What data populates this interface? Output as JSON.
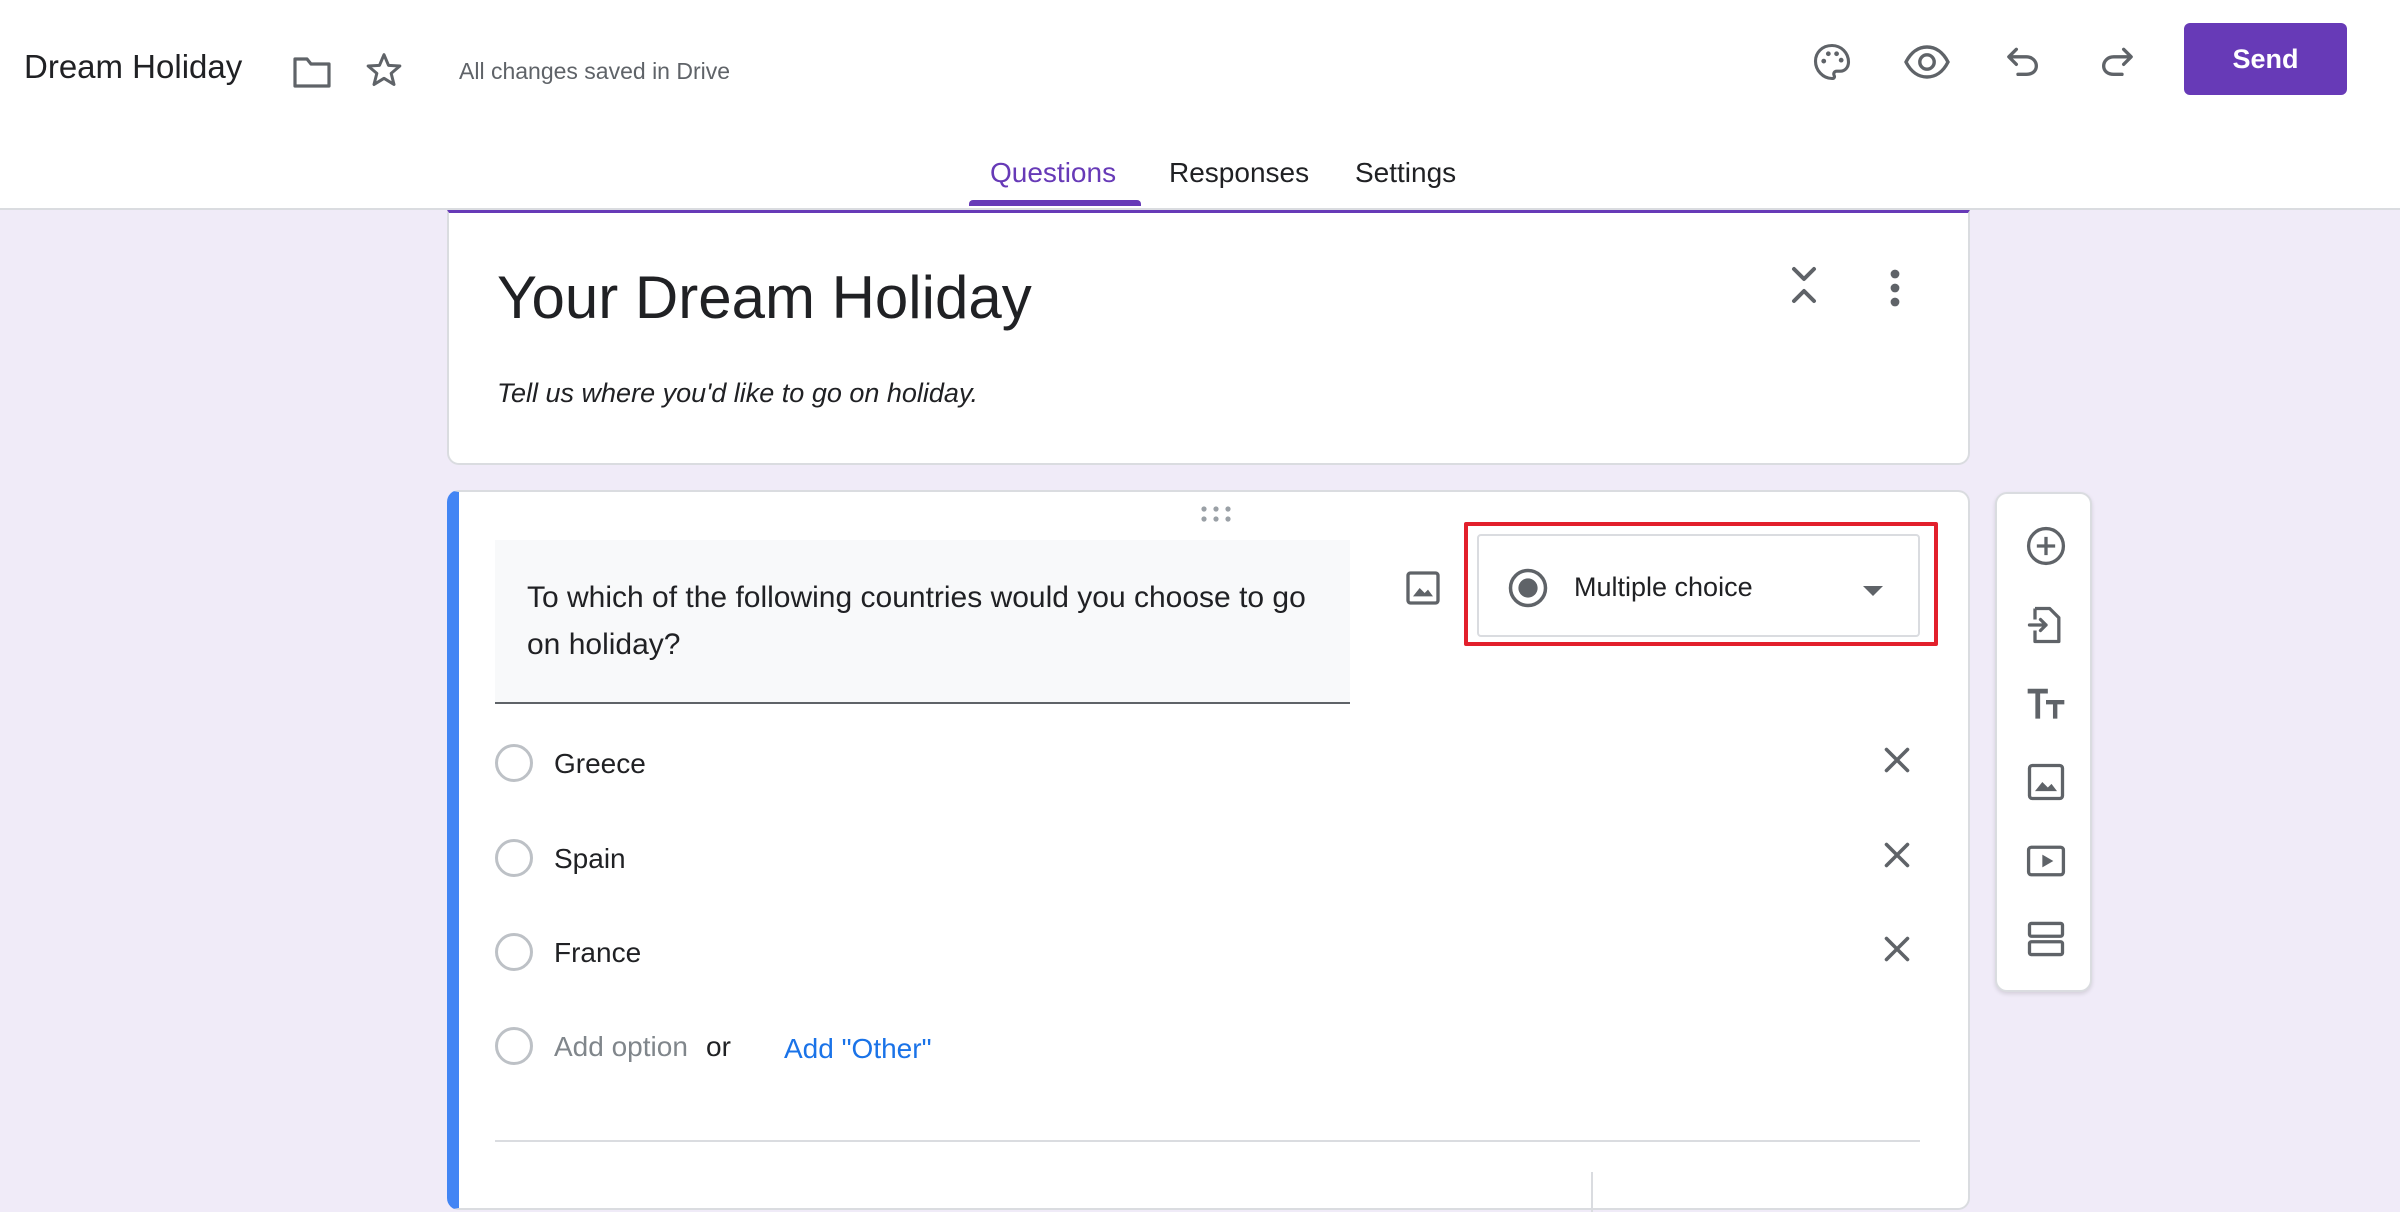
{
  "header": {
    "doc_title": "Dream Holiday",
    "saved_status": "All changes saved in Drive",
    "send_label": "Send",
    "icons": [
      "folder-icon",
      "star-icon",
      "palette-icon",
      "preview-eye-icon",
      "undo-icon",
      "redo-icon"
    ]
  },
  "tabs": [
    {
      "label": "Questions",
      "active": true
    },
    {
      "label": "Responses",
      "active": false
    },
    {
      "label": "Settings",
      "active": false
    }
  ],
  "form": {
    "title": "Your Dream Holiday",
    "description": "Tell us where you'd like to go on holiday."
  },
  "question": {
    "text": "To which of the following countries would you choose to go on holiday?",
    "type": "Multiple choice",
    "options": [
      "Greece",
      "Spain",
      "France"
    ],
    "add_option": "Add option",
    "or_text": "or",
    "add_other": "Add \"Other\""
  },
  "toolbar": {
    "buttons": [
      "add-question",
      "import-questions",
      "add-title-description",
      "add-image",
      "add-video",
      "add-section"
    ]
  },
  "colors": {
    "accent": "#673ab7",
    "background": "#f0ebf8",
    "active_question_border": "#4285f4",
    "highlight": "#e2202c",
    "link": "#1a73e8"
  }
}
